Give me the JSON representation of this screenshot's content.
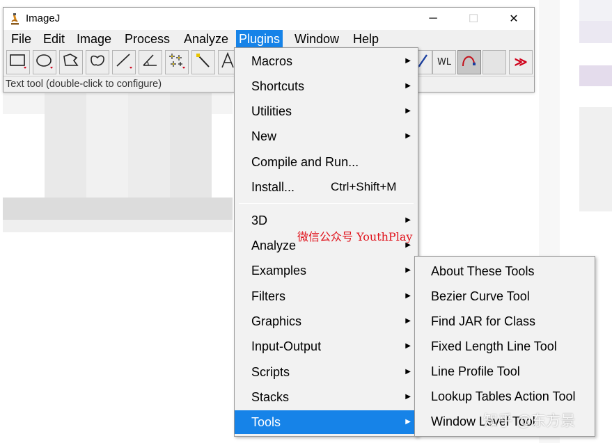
{
  "window": {
    "title": "ImageJ",
    "minimize_glyph": "─",
    "maximize_glyph": "☐",
    "close_glyph": "✕"
  },
  "menubar": {
    "items": [
      "File",
      "Edit",
      "Image",
      "Process",
      "Analyze",
      "Plugins",
      "Window",
      "Help"
    ],
    "active": "Plugins"
  },
  "toolbar": {
    "tools": [
      "rectangle-tool",
      "oval-tool",
      "polygon-tool",
      "freehand-tool",
      "line-tool",
      "angle-tool",
      "multi-point-tool",
      "wand-tool",
      "text-tool"
    ],
    "right_tools": [
      {
        "icon": "pencil-tool-icon"
      },
      {
        "label": "WL",
        "icon": "window-level-tool"
      },
      {
        "icon": "bezier-curve-tool-icon",
        "selected": true
      },
      {
        "icon": "empty-slot"
      },
      {
        "label": "≫",
        "icon": "more-tools-icon"
      }
    ]
  },
  "status": {
    "text": "Text tool (double-click to configure)"
  },
  "plugins_menu": {
    "items": [
      {
        "label": "Macros",
        "submenu": true
      },
      {
        "label": "Shortcuts",
        "submenu": true
      },
      {
        "label": "Utilities",
        "submenu": true
      },
      {
        "label": "New",
        "submenu": true
      },
      {
        "label": "Compile and Run...",
        "submenu": false
      },
      {
        "label": "Install...",
        "submenu": false,
        "shortcut": "Ctrl+Shift+M"
      },
      {
        "label": "3D",
        "submenu": true
      },
      {
        "label": "Analyze",
        "submenu": true
      },
      {
        "label": "Examples",
        "submenu": true
      },
      {
        "label": "Filters",
        "submenu": true
      },
      {
        "label": "Graphics",
        "submenu": true
      },
      {
        "label": "Input-Output",
        "submenu": true
      },
      {
        "label": "Scripts",
        "submenu": true
      },
      {
        "label": "Stacks",
        "submenu": true
      },
      {
        "label": "Tools",
        "submenu": true
      }
    ],
    "active": "Tools",
    "arrow_glyph": "▶"
  },
  "tools_submenu": {
    "items": [
      "About These Tools",
      "Bezier Curve Tool",
      "Find JAR for Class",
      "Fixed Length Line Tool",
      "Line Profile Tool",
      "Lookup Tables Action Tool",
      "Window Level Tool"
    ]
  },
  "watermarks": {
    "red": "微信公众号 YouthPlay",
    "zhihu": "知乎 @东方景"
  },
  "colors": {
    "accent": "#1683e8",
    "menu_bg": "#f2f2f2",
    "window_bg": "#f0f0f0",
    "watermark_red": "#e0121b",
    "tool_arrow_red": "#d0021b"
  }
}
